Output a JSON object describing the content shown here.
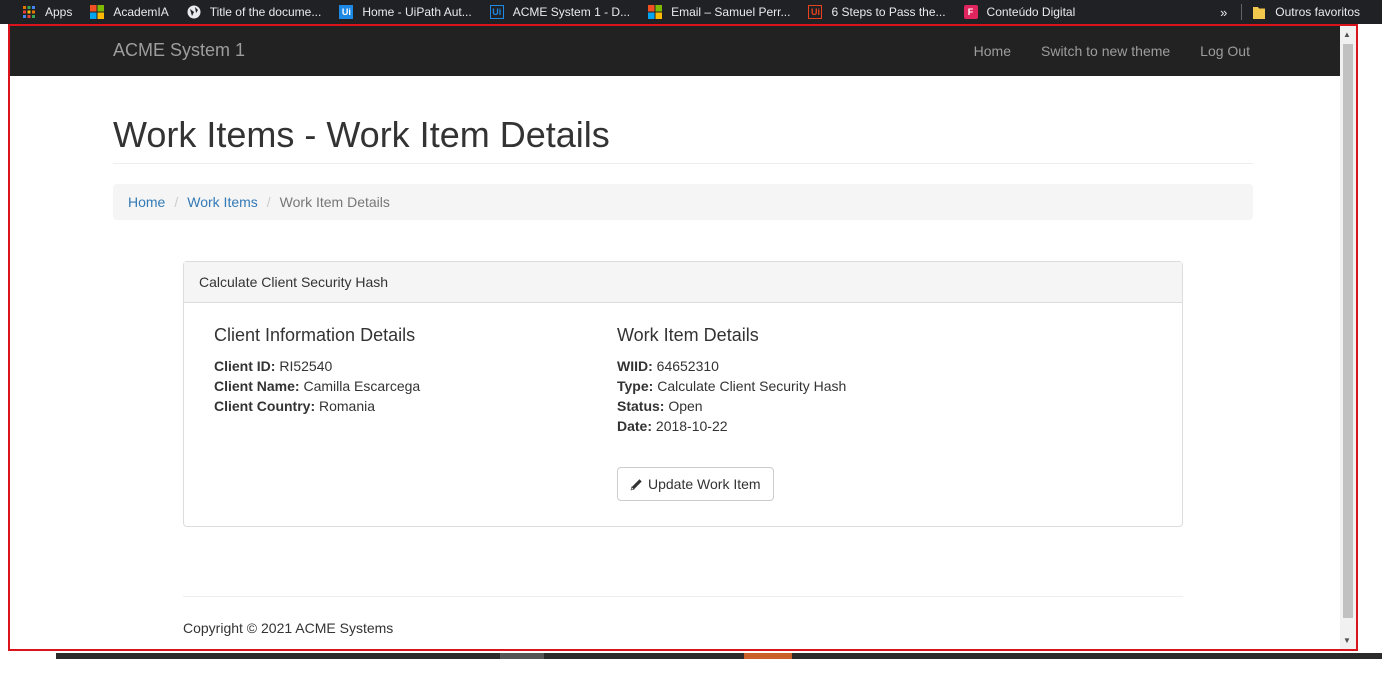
{
  "bookmarks": {
    "items": [
      {
        "label": "Apps",
        "icon": "apps-grid-icon",
        "color": "#e37400"
      },
      {
        "label": "AcademIA",
        "icon": "microsoft-icon",
        "color": "#f25022"
      },
      {
        "label": "Title of the docume...",
        "icon": "globe-icon",
        "color": "#e8eaed"
      },
      {
        "label": "Home - UiPath Aut...",
        "icon": "uipath-icon",
        "color": "#1e88e5"
      },
      {
        "label": "ACME System 1 - D...",
        "icon": "uipath-outline-icon",
        "color": "#1e88e5"
      },
      {
        "label": "Email – Samuel Perr...",
        "icon": "microsoft-icon",
        "color": "#f25022"
      },
      {
        "label": "6 Steps to Pass the...",
        "icon": "uipath-orange-icon",
        "color": "#e8431c"
      },
      {
        "label": "Conteúdo Digital",
        "icon": "f-icon",
        "color": "#e0245e"
      }
    ],
    "more": "»",
    "other": "Outros favoritos"
  },
  "navbar": {
    "brand": "ACME System 1",
    "links": [
      "Home",
      "Switch to new theme",
      "Log Out"
    ]
  },
  "page": {
    "title": "Work Items - Work Item Details"
  },
  "breadcrumb": {
    "home": "Home",
    "work_items": "Work Items",
    "current": "Work Item Details",
    "divider": "/"
  },
  "panel": {
    "heading": "Calculate Client Security Hash",
    "client": {
      "title": "Client Information Details",
      "id_label": "Client ID:",
      "id_value": "RI52540",
      "name_label": "Client Name:",
      "name_value": "Camilla Escarcega",
      "country_label": "Client Country:",
      "country_value": "Romania"
    },
    "work_item": {
      "title": "Work Item Details",
      "wiid_label": "WIID:",
      "wiid_value": "64652310",
      "type_label": "Type:",
      "type_value": "Calculate Client Security Hash",
      "status_label": "Status:",
      "status_value": "Open",
      "date_label": "Date:",
      "date_value": "2018-10-22"
    },
    "update_button": "Update Work Item"
  },
  "footer": {
    "copyright": "Copyright © 2021 ACME Systems"
  },
  "colors": {
    "navbar_bg": "#222222",
    "link": "#337ab7",
    "frame_border": "#d9141c"
  }
}
